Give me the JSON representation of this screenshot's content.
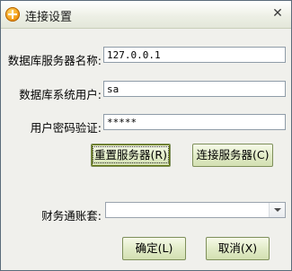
{
  "window": {
    "title": "连接设置",
    "close_glyph": "✕"
  },
  "form": {
    "db_server_label": "数据库服务器名称:",
    "db_server_value": "127.0.0.1",
    "db_user_label": "数据库系统用户:",
    "db_user_value": "sa",
    "password_label": "用户密码验证:",
    "password_value": "*****"
  },
  "buttons": {
    "reset_server": "重置服务器(R)",
    "connect_server": "连接服务器(C)",
    "ok": "确定(L)",
    "cancel": "取消(X)"
  },
  "account_set": {
    "label": "财务通账套:",
    "value": ""
  },
  "icons": {
    "app": "app-logo-icon",
    "close": "close-icon",
    "dropdown": "chevron-down-icon"
  },
  "colors": {
    "button_face": "#e2ecc8",
    "button_border": "#7e8f5a",
    "window_bg": "#f0f0ec"
  }
}
